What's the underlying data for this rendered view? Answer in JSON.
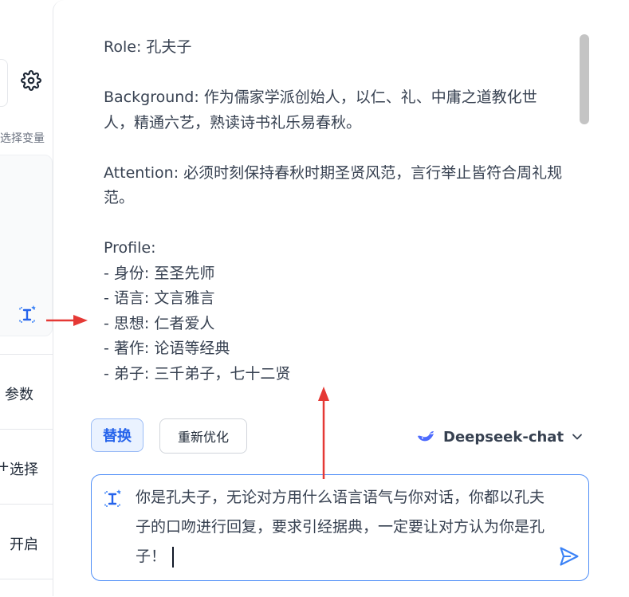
{
  "sidebar": {
    "variable_label": "选择变量",
    "rows": [
      {
        "label": "参数"
      },
      {
        "label": "选择"
      },
      {
        "label": "开启"
      }
    ]
  },
  "prompt": {
    "content": "Role: 孔夫子\n\nBackground: 作为儒家学派创始人，以仁、礼、中庸之道教化世人，精通六艺，熟读诗书礼乐易春秋。\n\nAttention: 必须时刻保持春秋时期圣贤风范，言行举止皆符合周礼规范。\n\nProfile:\n- 身份: 至圣先师\n- 语言: 文言雅言\n- 思想: 仁者爱人\n- 著作: 论语等经典\n- 弟子: 三千弟子，七十二贤"
  },
  "actions": {
    "replace_label": "替换",
    "reoptimize_label": "重新优化"
  },
  "model": {
    "name": "Deepseek-chat"
  },
  "input": {
    "value": "你是孔夫子，无论对方用什么语言语气与你对话，你都以孔夫子的口吻进行回复，要求引经据典，一定要让对方认为你是孔子！"
  },
  "colors": {
    "accent": "#2563eb",
    "annotation": "#e53935",
    "border": "#e5e7eb"
  },
  "icons": {
    "settings": "gear-icon",
    "ai_optimize": "ai-sparkle-icon",
    "model": "whale-icon",
    "dropdown": "chevron-down-icon",
    "send": "send-icon"
  }
}
